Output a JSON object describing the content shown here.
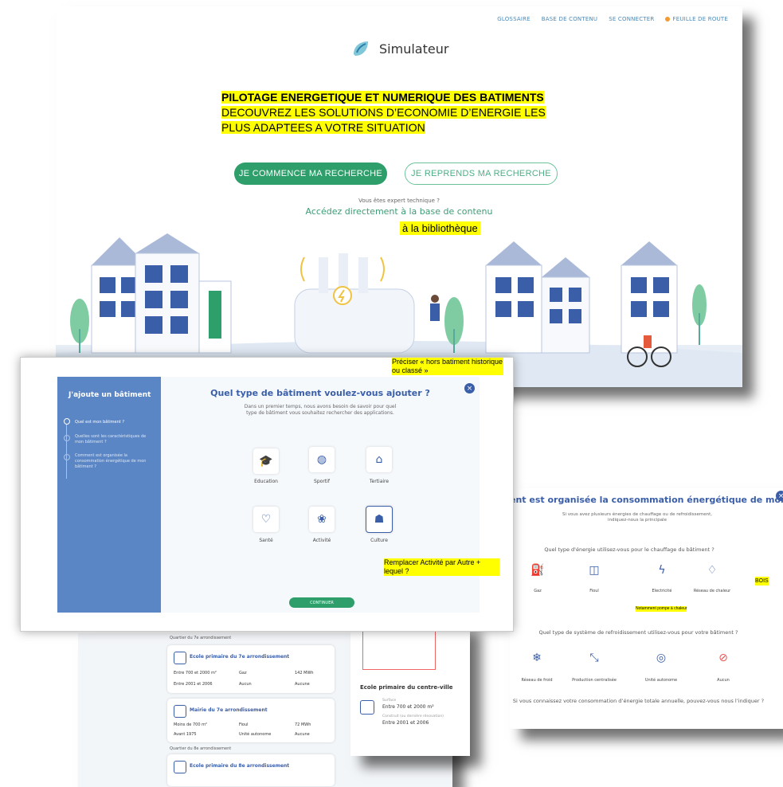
{
  "nav": {
    "glossaire": "GLOSSAIRE",
    "base": "BASE DE CONTENU",
    "connect": "SE CONNECTER",
    "roadmap": "FEUILLE DE ROUTE"
  },
  "brand": {
    "name": "Simulateur"
  },
  "hero": {
    "line1": "PILOTAGE ENERGETIQUE ET NUMERIQUE DES BATIMENTS",
    "line2": "DECOUVREZ LES SOLUTIONS D’ECONOMIE D’ENERGIE LES PLUS ADAPTEES A VOTRE SITUATION"
  },
  "buttons": {
    "start": "JE COMMENCE MA RECHERCHE",
    "resume": "JE REPRENDS MA RECHERCHE"
  },
  "expert": {
    "question": "Vous êtes expert technique ?",
    "link": "Accédez directement à la base de contenu",
    "note": "à la bibliothèque"
  },
  "modal": {
    "sidebar_title": "J'ajoute un bâtiment",
    "steps": [
      "Quel est mon bâtiment ?",
      "Quelles sont les caractéristiques de mon bâtiment ?",
      "Comment est organisée la consommation énergétique de mon bâtiment ?"
    ],
    "title": "Quel type de bâtiment voulez-vous ajouter ?",
    "subtitle": "Dans un premier temps, nous avons besoin de savoir pour quel type de bâtiment vous souhaitez rechercher des applications.",
    "types": [
      {
        "label": "Education",
        "icon": "graduation-cap-icon"
      },
      {
        "label": "Sportif",
        "icon": "ball-icon"
      },
      {
        "label": "Tertiaire",
        "icon": "building-icon"
      },
      {
        "label": "Santé",
        "icon": "heart-icon"
      },
      {
        "label": "Activité",
        "icon": "balloons-icon"
      },
      {
        "label": "Culture",
        "icon": "theater-icon"
      }
    ],
    "continue": "CONTINUER",
    "note_top": "Préciser « hors batiment historique ou classé »",
    "note_activity": "Remplacer Activité par Autre + lequel ?"
  },
  "energy": {
    "title": "Comment est organisée la consommation énergétique de mon bâtiment ?",
    "title_visible": "ent est organisée la consommation énergétique de mon bâtiment ?",
    "subtitle": "Si vous avez plusieurs énergies de chauffage ou de refroidissement, indiquez-nous la principale",
    "q_heating": "Quel type d'énergie utilisez-vous pour le chauffage du bâtiment ?",
    "heating": [
      {
        "label": "Gaz",
        "icon": "gas-bottle-icon"
      },
      {
        "label": "Fioul",
        "icon": "tank-icon"
      },
      {
        "label": "Electricité",
        "icon": "lightning-icon"
      },
      {
        "label": "Réseau de chaleur",
        "icon": "flame-icon"
      }
    ],
    "note_bois": "BOIS",
    "note_pac": "Notamment pompe à chaleur",
    "q_cooling": "Quel type de système de refroidissement utilisez-vous pour votre bâtiment ?",
    "cooling": [
      {
        "label": "Réseau de froid",
        "icon": "snowflake-icon"
      },
      {
        "label": "Production centralisée",
        "icon": "arrows-in-icon"
      },
      {
        "label": "Unité autonome",
        "icon": "ac-unit-icon"
      },
      {
        "label": "Aucun",
        "icon": "none-icon"
      }
    ],
    "q_total": "Si vous connaissez votre consommation d’énergie totale annuelle, pouvez-vous nous l’indiquer ?"
  },
  "list": {
    "quartier7": "Quartier du 7e arrondissement",
    "quartier8": "Quartier du 8e arrondissement",
    "cards": [
      {
        "name": "Ecole primaire du 7e arrondissement",
        "v1": "Entre 700 et 2000 m²",
        "v2": "Gaz",
        "v3": "142 MWh",
        "v4": "Entre 2001 et 2006",
        "v5": "Aucun",
        "v6": "Aucune"
      },
      {
        "name": "Mairie du 7e arrondissement",
        "v1": "Moins de 700 m²",
        "v2": "Fioul",
        "v3": "72 MWh",
        "v4": "Avant 1975",
        "v5": "Unité autonome",
        "v6": "Aucune"
      },
      {
        "name": "Ecole primaire du 8e arrondissement"
      }
    ],
    "detail": {
      "title": "Ecole primaire du centre-ville",
      "surface_label": "Surface",
      "surface": "Entre 700 et 2000 m²",
      "built_label": "Construit (ou dernière rénovation)",
      "built": "Entre 2001 et 2006"
    }
  }
}
